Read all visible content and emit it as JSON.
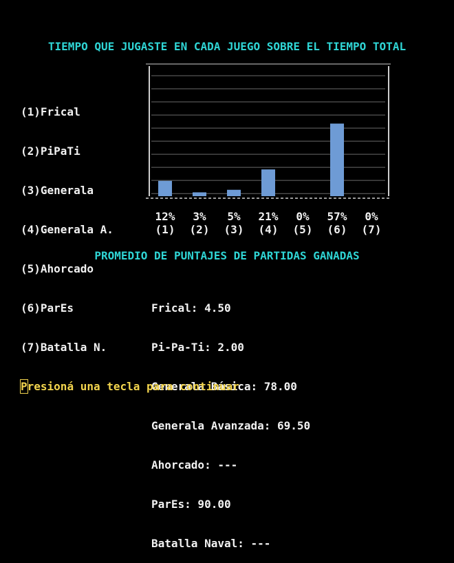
{
  "chart_data": {
    "type": "bar",
    "title": "TIEMPO QUE JUGASTE EN CADA JUEGO SOBRE EL TIEMPO TOTAL",
    "categories": [
      "(1)",
      "(2)",
      "(3)",
      "(4)",
      "(5)",
      "(6)",
      "(7)"
    ],
    "value_labels": [
      "12%",
      "3%",
      "5%",
      "21%",
      "0%",
      "57%",
      "0%"
    ],
    "values": [
      12,
      3,
      5,
      21,
      0,
      57,
      0
    ],
    "ylim": [
      0,
      100
    ],
    "grid": true,
    "bar_color": "#6e9bd5"
  },
  "legend": [
    "(1)Frical",
    "(2)PiPaTi",
    "(3)Generala",
    "(4)Generala A.",
    "(5)Ahorcado",
    "(6)ParEs",
    "(7)Batalla N."
  ],
  "scores": {
    "title": "PROMEDIO DE PUNTAJES DE PARTIDAS GANADAS",
    "lines": [
      "Frical: 4.50",
      "Pi-Pa-Ti: 2.00",
      "Generala Básica: 78.00",
      "Generala Avanzada: 69.50",
      "Ahorcado: ---",
      "ParEs: 90.00",
      "Batalla Naval: ---"
    ]
  },
  "prompt": {
    "first_char": "P",
    "rest": "resioná una tecla para continuar"
  },
  "colors": {
    "background": "#000000",
    "heading": "#2fd5d5",
    "prompt": "#f3d54e",
    "text": "#f2f2f2"
  }
}
